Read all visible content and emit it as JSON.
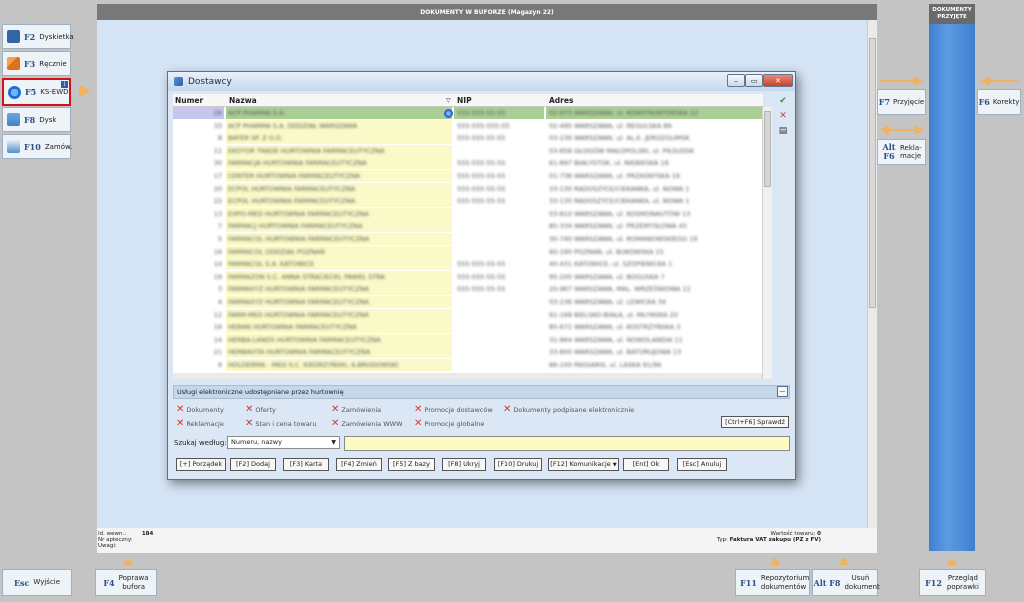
{
  "left_buttons": [
    {
      "key": "F2",
      "label": "Dyskietka",
      "icon": "floppy-icon",
      "color": "#3565a8"
    },
    {
      "key": "F3",
      "label": "Ręcznie",
      "icon": "pencil-icon",
      "color": "#e0701c"
    },
    {
      "key": "F5",
      "label": "KS-EWD",
      "icon": "globe-icon",
      "color": "#1f6fd0",
      "selected": true,
      "badge": "i"
    },
    {
      "key": "F8",
      "label": "Dysk",
      "icon": "folder-icon",
      "color": "#3f86c8"
    },
    {
      "key": "F10",
      "label": "Zamów.",
      "icon": "checklist-icon",
      "color": "#4f8fcf"
    }
  ],
  "main_window": {
    "title": "DOKUMENTY W BUFORZE (Magazyn 22)"
  },
  "right_panel": {
    "title": "DOKUMENTY PRZYJĘTE",
    "buttons": [
      {
        "key": "F7",
        "label": "Przyjęcie"
      },
      {
        "key": "F6",
        "label": "Korekty"
      },
      {
        "key": "Alt F6",
        "label": "Rekla- macje"
      }
    ]
  },
  "dialog": {
    "title": "Dostawcy",
    "columns": [
      "Numer",
      "Nazwa",
      "NIP",
      "Adres"
    ],
    "rows": [
      {
        "num": "26",
        "name": "ACP PHARMA S.A.",
        "nip": "555-555-55-55",
        "addr": "02-673 WARSZAWA, ul. KONSTRUKTORSKA 12",
        "selected": true
      },
      {
        "num": "33",
        "name": "ACP PHARMA S.A. ODDZIAŁ WARSZAWA",
        "nip": "555-555-555-55",
        "addr": "02-495 WARSZAWA, ul. REGULSKA 89"
      },
      {
        "num": "8",
        "name": "BAYER SP. Z O.O.",
        "nip": "555-555-55-55",
        "addr": "03-236 WARSZAWA, ul. AL.E. JEROZOLIMSK"
      },
      {
        "num": "11",
        "name": "EKOTOR TRADE HURTOWNIA FARMACEUTYCZNA",
        "nip": "",
        "addr": "03-858 GŁOGÓW MAŁOPOLSKI, ul. PIŁSUDSK"
      },
      {
        "num": "30",
        "name": "FARMACJA HURTOWNIA FARMACEUTYCZNA",
        "nip": "555-555-55-55",
        "addr": "61-897 BIAŁYSTOK, ul. NIEBIESKA 19"
      },
      {
        "num": "17",
        "name": "CENTER HURTOWNIA FARMACEUTYCZNA",
        "nip": "555-555-55-55",
        "addr": "01-738 WARSZAWA, ul. PRZASNYSKA 19"
      },
      {
        "num": "20",
        "name": "ECPOL HURTOWNIA FARMACEUTYCZNA",
        "nip": "555-555-55-55",
        "addr": "33-130 RADOSZYCE/CIEKANKA, ul. NOWA 1"
      },
      {
        "num": "22",
        "name": "ECPOL HURTOWNIA FARMACEUTYCZNA",
        "nip": "555-555-55-55",
        "addr": "33-130 RADOSZYCE/CIEKANKA, ul. NOWA 1"
      },
      {
        "num": "13",
        "name": "EXPO-MED HURTOWNIA FARMACEUTYCZNA",
        "nip": "",
        "addr": "03-810 WARSZAWA, ul. KOSMONAUTÓW 13"
      },
      {
        "num": "7",
        "name": "FARMACJ HURTOWNIA FARMACEUTYCZNA",
        "nip": "",
        "addr": "85-334 WARSZAWA, ul. PRZEMYSŁOWA 45"
      },
      {
        "num": "5",
        "name": "FARMACOL HURTOWNIA FARMACEUTYCZNA",
        "nip": "",
        "addr": "30-740 WARSZAWA, ul. ROMANOWSKIEGO 19"
      },
      {
        "num": "16",
        "name": "FARMACOL ODDZIAŁ POZNAŃ",
        "nip": "",
        "addr": "60-190 POZNAŃ, ul. BUKOWSKA 15"
      },
      {
        "num": "14",
        "name": "FARMACOL S.A. KATOWICE",
        "nip": "555-555-55-55",
        "addr": "40-431 KATOWICE, ul. SZOPIENICKA 1"
      },
      {
        "num": "19",
        "name": "FARMAZON S.C. ANNA STRACIECKI, PAWEŁ STRA",
        "nip": "555-555-55-55",
        "addr": "95-200 WARSZAWA, ul. BOGUSKA 7"
      },
      {
        "num": "3",
        "name": "FARMAXYZ HURTOWNIA FARMACEUTYCZNA",
        "nip": "555-555-55-55",
        "addr": "20-967 WARSZAWA, MAL. WRZEŚNIOWA 12"
      },
      {
        "num": "4",
        "name": "FARMAXYZ HURTOWNIA FARMACEUTYCZNA",
        "nip": "",
        "addr": "03-236 WARSZAWA, ul. LEWICKA 34"
      },
      {
        "num": "12",
        "name": "FARM-MED HURTOWNIA FARMACEUTYCZNA",
        "nip": "",
        "addr": "91-168 BIELSKO-BIAŁA, ul. MŁYNSKA 20"
      },
      {
        "num": "16",
        "name": "HEBAN HURTOWNIA FARMACEUTYCZNA",
        "nip": "",
        "addr": "85-671 WARSZAWA, ul. KOSTRZYŃSKA 3"
      },
      {
        "num": "14",
        "name": "HERBA-LANDS HURTOWNIA FARMACEUTYCZNA",
        "nip": "",
        "addr": "31-864 WARSZAWA, ul. NOWOLANDIA 11"
      },
      {
        "num": "21",
        "name": "HERBAVITA HURTOWNIA FARMACEUTYCZNA",
        "nip": "",
        "addr": "33-800 WARSZAWA, ul. BATORUJOWA 13"
      },
      {
        "num": "9",
        "name": "HOLDERMA - MED S.C. KIEDRZYŃSKI, A.BRODOWSKI",
        "nip": "",
        "addr": "86-100 PASSARIS, ul. LASKA 91/96"
      }
    ],
    "services_header": "Usługi elektroniczne udostępniane przez hurtownię",
    "services": [
      "Dokumenty",
      "Reklamacje",
      "Oferty",
      "Stan i cena towaru",
      "Zamówienia",
      "Zamówienia WWW",
      "Promocje dostawców",
      "Promocje globalne",
      "Dokumenty podpisane elektronicznie"
    ],
    "check_button": "[Ctrl+F6] Sprawdź",
    "search_label": "Szukaj według:",
    "search_option": "Numeru, nazwy",
    "search_value": "",
    "buttons": [
      "[+] Porządek",
      "[F2] Dodaj",
      "[F3] Karta",
      "[F4] Zmień",
      "[F5] Z bazy",
      "[F8] Ukryj",
      "[F10] Drukuj",
      "[F12] Komunikacje",
      "[Ent] Ok",
      "[Esc] Anuluj"
    ]
  },
  "footer": {
    "id_label": "Id. wewn.:",
    "id_value": "184",
    "nr_label": "Nr apteczny:",
    "uwagi_label": "Uwagi:",
    "value_label": "Wartość towaru:",
    "value": "0",
    "type_label": "Typ:",
    "type_value": "Faktura VAT zakupu (PZ z FV)"
  },
  "bottom_buttons": [
    {
      "key": "Esc",
      "label": "Wyjście"
    },
    {
      "key": "F4",
      "label": "Poprawa bufora"
    },
    {
      "key": "F11",
      "label": "Repozytorium dokumentów"
    },
    {
      "key": "Alt F8",
      "label": "Usuń dokument"
    },
    {
      "key": "F12",
      "label": "Przegląd poprawki"
    }
  ],
  "colors": {
    "accent_blue": "#2c4f86",
    "selected_border": "#d0121f",
    "selected_row": "#a9cf95",
    "arrow": "#f0b35c",
    "delete_red": "#d23a2e"
  }
}
